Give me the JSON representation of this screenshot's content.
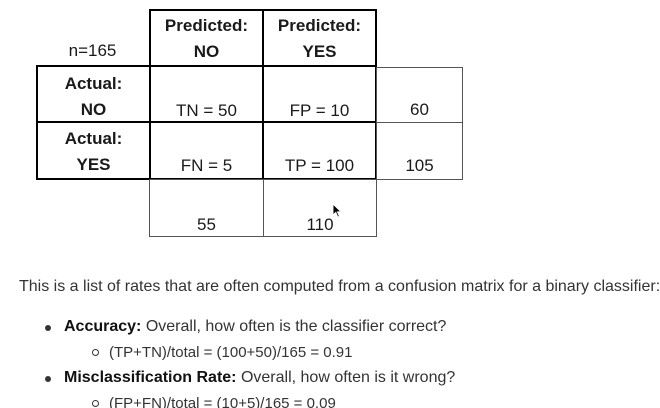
{
  "matrix": {
    "n_label": "n=165",
    "header_no": {
      "line1": "Predicted:",
      "line2": "NO"
    },
    "header_yes": {
      "line1": "Predicted:",
      "line2": "YES"
    },
    "row_no": {
      "line1": "Actual:",
      "line2": "NO"
    },
    "row_yes": {
      "line1": "Actual:",
      "line2": "YES"
    },
    "tn": "TN = 50",
    "fp": "FP = 10",
    "fn": "FN = 5",
    "tp": "TP = 100",
    "row_total_no": "60",
    "row_total_yes": "105",
    "col_total_no": "55",
    "col_total_yes": "110"
  },
  "text": {
    "intro": "This is a list of rates that are often computed from a confusion matrix for a binary classifier:",
    "accuracy_term": "Accuracy:",
    "accuracy_desc": " Overall, how often is the classifier correct?",
    "accuracy_formula": "(TP+TN)/total = (100+50)/165 = 0.91",
    "misclass_term": "Misclassification Rate:",
    "misclass_desc": " Overall, how often is it wrong?",
    "misclass_formula": "(FP+FN)/total = (10+5)/165 = 0.09"
  },
  "icons": {
    "cursor": "mouse-pointer-icon"
  }
}
